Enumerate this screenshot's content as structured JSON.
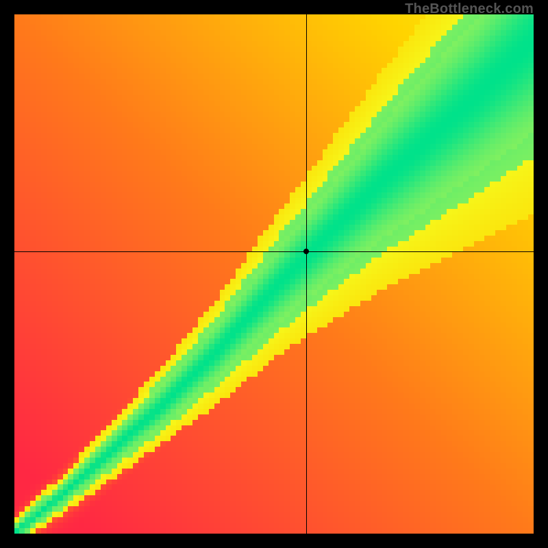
{
  "watermark": "TheBottleneck.com",
  "chart_data": {
    "type": "heatmap",
    "title": "",
    "xlabel": "",
    "ylabel": "",
    "xlim": [
      0,
      100
    ],
    "ylim": [
      0,
      100
    ],
    "crosshair": {
      "x_frac": 0.562,
      "y_frac": 0.456
    },
    "grid_resolution": 96,
    "color_ramp": {
      "stops": [
        {
          "t": 0.0,
          "color": "#ff1a4a"
        },
        {
          "t": 0.35,
          "color": "#ff7a1a"
        },
        {
          "t": 0.6,
          "color": "#ffd400"
        },
        {
          "t": 0.78,
          "color": "#f4ff20"
        },
        {
          "t": 0.88,
          "color": "#80f060"
        },
        {
          "t": 1.0,
          "color": "#00e28a"
        }
      ]
    },
    "ridge": {
      "description": "Fitness peak is a curved diagonal band from lower-left to upper-right; band width grows toward the top-right.",
      "control_points": [
        {
          "x": 0.0,
          "y": 1.0,
          "width": 0.01
        },
        {
          "x": 0.1,
          "y": 0.92,
          "width": 0.015
        },
        {
          "x": 0.2,
          "y": 0.83,
          "width": 0.022
        },
        {
          "x": 0.3,
          "y": 0.74,
          "width": 0.03
        },
        {
          "x": 0.4,
          "y": 0.64,
          "width": 0.04
        },
        {
          "x": 0.5,
          "y": 0.53,
          "width": 0.052
        },
        {
          "x": 0.6,
          "y": 0.43,
          "width": 0.065
        },
        {
          "x": 0.7,
          "y": 0.33,
          "width": 0.08
        },
        {
          "x": 0.8,
          "y": 0.24,
          "width": 0.095
        },
        {
          "x": 0.9,
          "y": 0.15,
          "width": 0.11
        },
        {
          "x": 1.0,
          "y": 0.05,
          "width": 0.13
        }
      ]
    },
    "background_gradient": {
      "axis": "u_plus_v",
      "low": 0.0,
      "high": 0.7
    }
  }
}
